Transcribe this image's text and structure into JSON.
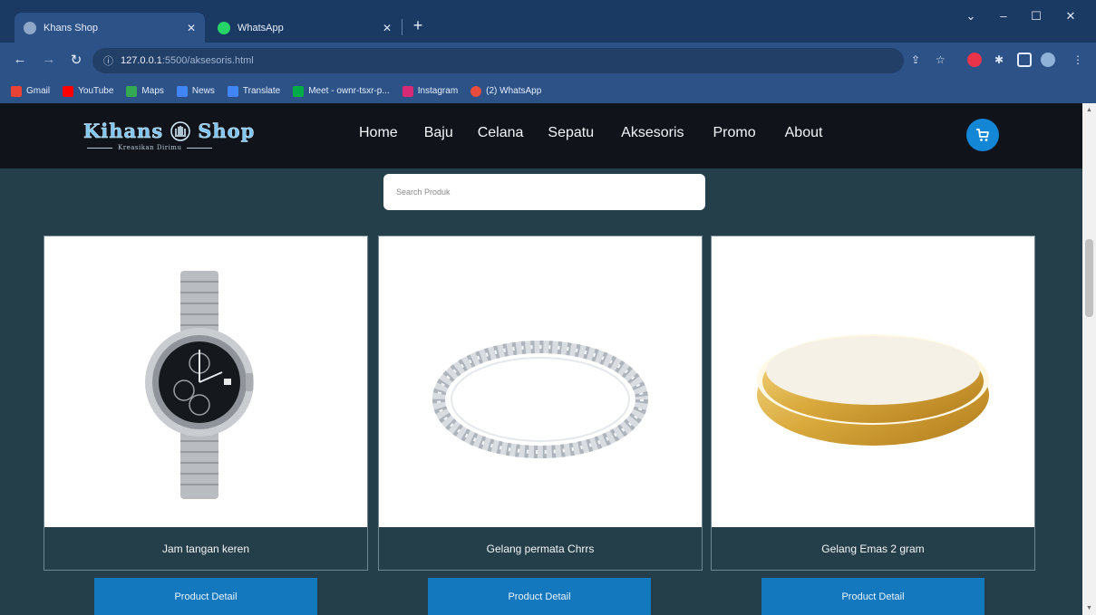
{
  "browser": {
    "tabs": [
      {
        "title": "Khans Shop",
        "active": true
      },
      {
        "title": "WhatsApp",
        "active": false
      }
    ],
    "url_host": "127.0.0.1",
    "url_path": ":5500/aksesoris.html",
    "bookmarks": [
      {
        "label": "Gmail",
        "color": "#ea4335"
      },
      {
        "label": "YouTube",
        "color": "#ff0000"
      },
      {
        "label": "Maps",
        "color": "#34a853"
      },
      {
        "label": "News",
        "color": "#4285f4"
      },
      {
        "label": "Translate",
        "color": "#4285f4"
      },
      {
        "label": "Meet - ownr-tsxr-p...",
        "color": "#00ac47"
      },
      {
        "label": "Instagram",
        "color": "#d62976"
      },
      {
        "label": "(2) WhatsApp",
        "color": "#e94b3c"
      }
    ]
  },
  "site": {
    "logo_name": "Kihans",
    "logo_name2": "Shop",
    "logo_tagline": "Kreasikan Dirimu",
    "nav": [
      "Home",
      "Baju",
      "Celana",
      "Sepatu",
      "Aksesoris",
      "Promo",
      "About"
    ],
    "accent_color": "#1387d6"
  },
  "search": {
    "placeholder": "Search Produk"
  },
  "products": [
    {
      "name": "Jam tangan keren",
      "image_icon": "watch-image"
    },
    {
      "name": "Gelang permata Chrrs",
      "image_icon": "bracelet-image"
    },
    {
      "name": "Gelang Emas 2 gram",
      "image_icon": "gold-bangle-image"
    }
  ],
  "detail_label": "Product Detail"
}
